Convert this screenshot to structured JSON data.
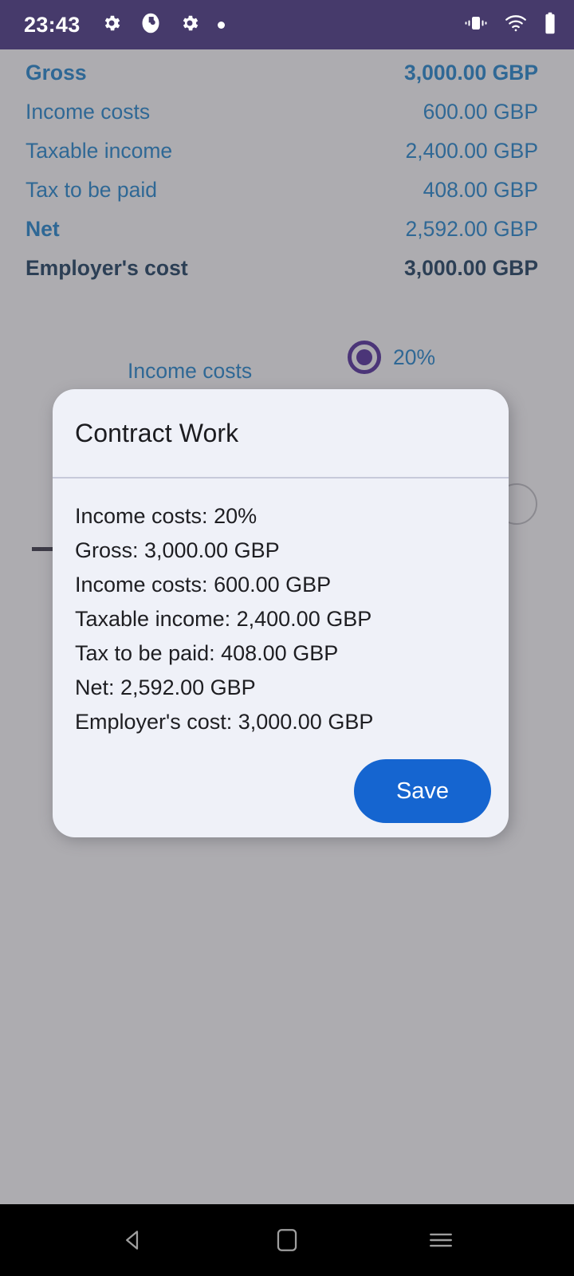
{
  "status_bar": {
    "clock": "23:43",
    "left_icons": [
      "gear-icon",
      "contrast-icon",
      "gear-icon",
      "dot-icon"
    ],
    "right_icons": [
      "vibrate-icon",
      "wifi-icon",
      "battery-icon"
    ],
    "background_color": "#463a6b"
  },
  "summary": {
    "rows": [
      {
        "label": "Gross",
        "value": "3,000.00 GBP",
        "style": "strong"
      },
      {
        "label": "Income costs",
        "value": "600.00 GBP",
        "style": "normal"
      },
      {
        "label": "Taxable income",
        "value": "2,400.00 GBP",
        "style": "normal"
      },
      {
        "label": "Tax to be paid",
        "value": "408.00 GBP",
        "style": "normal"
      },
      {
        "label": "Net",
        "value": "2,592.00 GBP",
        "style": "semi"
      },
      {
        "label": "Employer's cost",
        "value": "3,000.00 GBP",
        "style": "strong-dark"
      }
    ],
    "text_color": "#2f6895",
    "emphasis_color": "#2c3f55"
  },
  "background_form": {
    "income_costs_label": "Income costs",
    "radio_selected_label": "20%",
    "radio_accent_color": "#4b3578"
  },
  "dialog": {
    "title": "Contract Work",
    "background_color": "#eff1f8",
    "lines": [
      "Income costs: 20%",
      "Gross: 3,000.00 GBP",
      "Income costs: 600.00 GBP",
      "Taxable income: 2,400.00 GBP",
      "Tax to be paid: 408.00 GBP",
      "Net: 2,592.00 GBP",
      "Employer's cost: 3,000.00 GBP"
    ],
    "save_label": "Save",
    "save_color": "#1565d0"
  },
  "nav_bar": {
    "buttons": [
      "back-icon",
      "home-icon",
      "recents-icon"
    ],
    "background_color": "#000000"
  }
}
